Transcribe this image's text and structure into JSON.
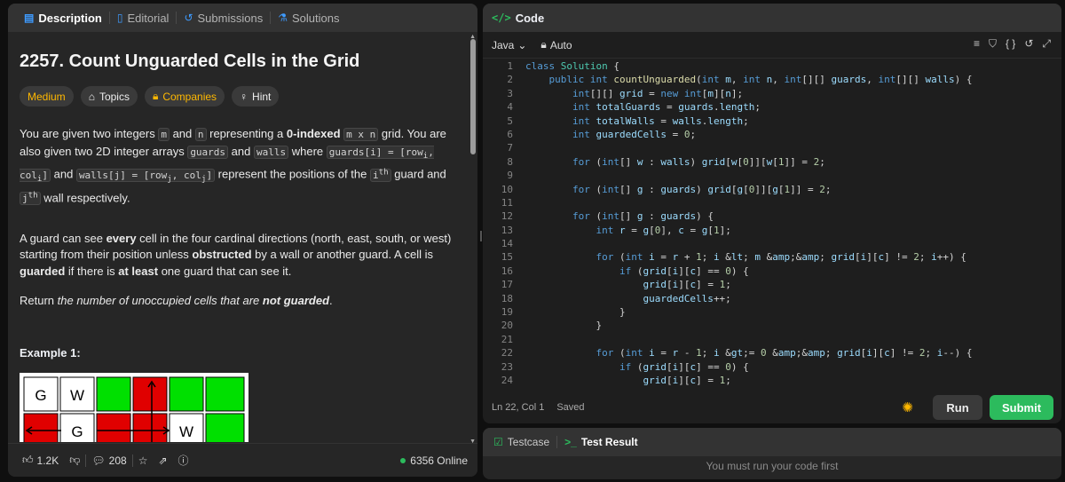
{
  "left": {
    "tabs": [
      {
        "label": "Description",
        "icon": "document-icon"
      },
      {
        "label": "Editorial",
        "icon": "book-icon"
      },
      {
        "label": "Submissions",
        "icon": "history-icon"
      },
      {
        "label": "Solutions",
        "icon": "flask-icon"
      }
    ],
    "title": "2257. Count Unguarded Cells in the Grid",
    "chips": {
      "difficulty": "Medium",
      "topics": "Topics",
      "companies": "Companies",
      "hint": "Hint"
    },
    "para1": {
      "a": "You are given two integers ",
      "m": "m",
      "b": " and ",
      "n": "n",
      "c": " representing a ",
      "bold": "0-indexed",
      "d": " ",
      "mxn": "m x n",
      "e": " grid. You are also given two 2D integer arrays ",
      "guards": "guards",
      "f": " and ",
      "walls": "walls",
      "g": " where ",
      "gi": "guards[i] = [row",
      "gi2": "i",
      "gi3": ", col",
      "gi4": "i",
      "gi5": "]",
      "h": " and ",
      "wj": "walls[j] = [row",
      "wj2": "j",
      "wj3": ", col",
      "wj4": "j",
      "wj5": "]",
      "i": " represent the positions of the ",
      "ith": "i",
      "ith_sup": "th",
      "j": " guard and ",
      "jth": "j",
      "jth_sup": "th",
      "k": " wall respectively."
    },
    "para2": {
      "a": "A guard can see ",
      "every": "every",
      "b": " cell in the four cardinal directions (north, east, south, or west) starting from their position unless ",
      "obstructed": "obstructed",
      "c": " by a wall or another guard. A cell is ",
      "guarded": "guarded",
      "d": " if there is ",
      "atleast": "at least",
      "e": " one guard that can see it."
    },
    "para3": {
      "a": "Return ",
      "b": "the number of unoccupied cells that are ",
      "not": "not guarded",
      "c": "."
    },
    "example_label": "Example 1:",
    "grid_labels": {
      "g": "G",
      "w": "W"
    },
    "footer": {
      "likes": "1.2K",
      "comments": "208",
      "online": "6356 Online"
    }
  },
  "right": {
    "header": "Code",
    "language": "Java",
    "auto": "Auto",
    "code_lines": [
      "class Solution {",
      "    public int countUnguarded(int m, int n, int[][] guards, int[][] walls) {",
      "        int[][] grid = new int[m][n];",
      "        int totalGuards = guards.length;",
      "        int totalWalls = walls.length;",
      "        int guardedCells = 0;",
      "",
      "        for (int[] w : walls) grid[w[0]][w[1]] = 2;",
      "",
      "        for (int[] g : guards) grid[g[0]][g[1]] = 2;",
      "",
      "        for (int[] g : guards) {",
      "            int r = g[0], c = g[1];",
      "",
      "            for (int i = r + 1; i < m && grid[i][c] != 2; i++) {",
      "                if (grid[i][c] == 0) {",
      "                    grid[i][c] = 1;",
      "                    guardedCells++;",
      "                }",
      "            }",
      "",
      "            for (int i = r - 1; i >= 0 && grid[i][c] != 2; i--) {",
      "                if (grid[i][c] == 0) {",
      "                    grid[i][c] = 1;"
    ],
    "status": {
      "position": "Ln 22, Col 1",
      "saved": "Saved"
    },
    "run": "Run",
    "submit": "Submit",
    "bottom_tabs": {
      "testcase": "Testcase",
      "result": "Test Result"
    },
    "message": "You must run your code first"
  },
  "colors": {
    "accent_green": "#2cbb5d",
    "difficulty": "#ffb800",
    "grid_green": "#00e000",
    "grid_red": "#e00000"
  }
}
